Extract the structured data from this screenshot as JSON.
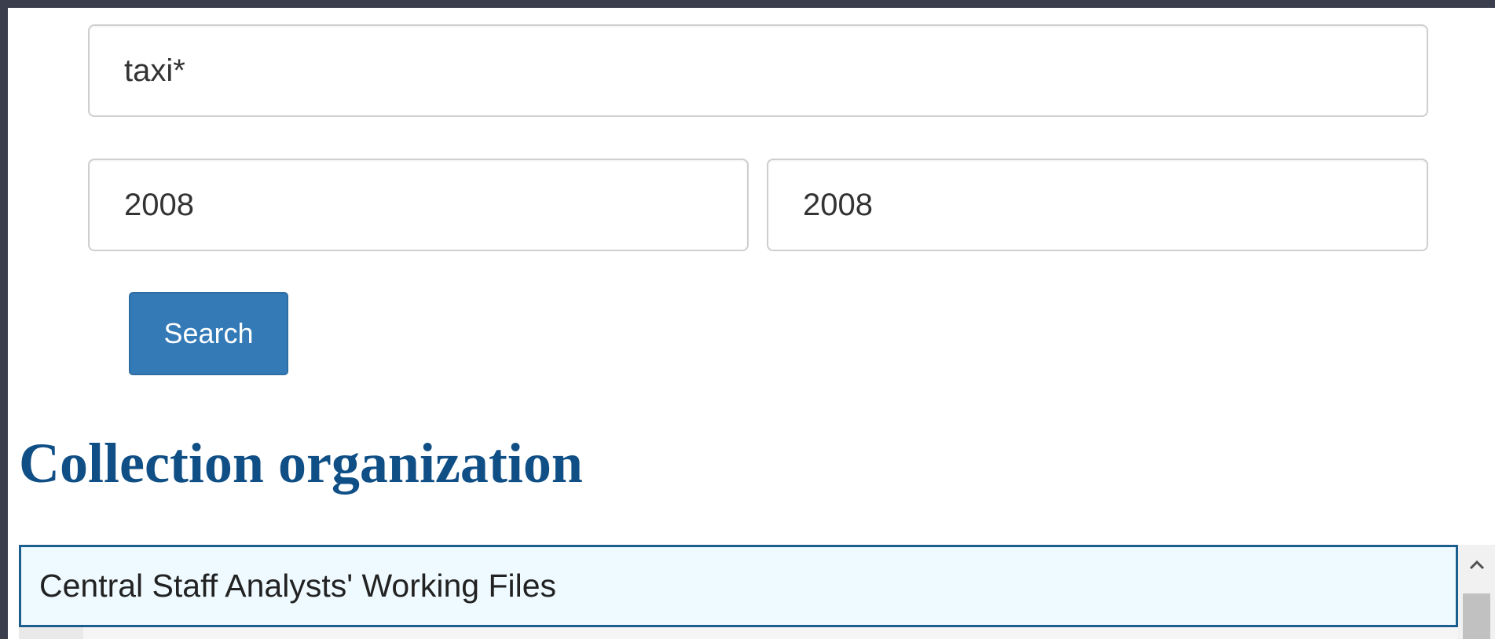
{
  "search_form": {
    "keyword_value": "taxi*",
    "year_from_value": "2008",
    "year_to_value": "2008",
    "search_button_label": "Search"
  },
  "collection": {
    "heading": "Collection organization",
    "items": [
      {
        "label": "Central Staff Analysts' Working Files"
      }
    ]
  },
  "icons": {
    "scroll_up": "chevron-up-icon"
  },
  "colors": {
    "button_bg": "#337ab7",
    "heading": "#0f4f86",
    "selected_item_bg": "#eefaff",
    "selected_item_border": "#1c5e8e",
    "frame": "#3b3f4d"
  }
}
